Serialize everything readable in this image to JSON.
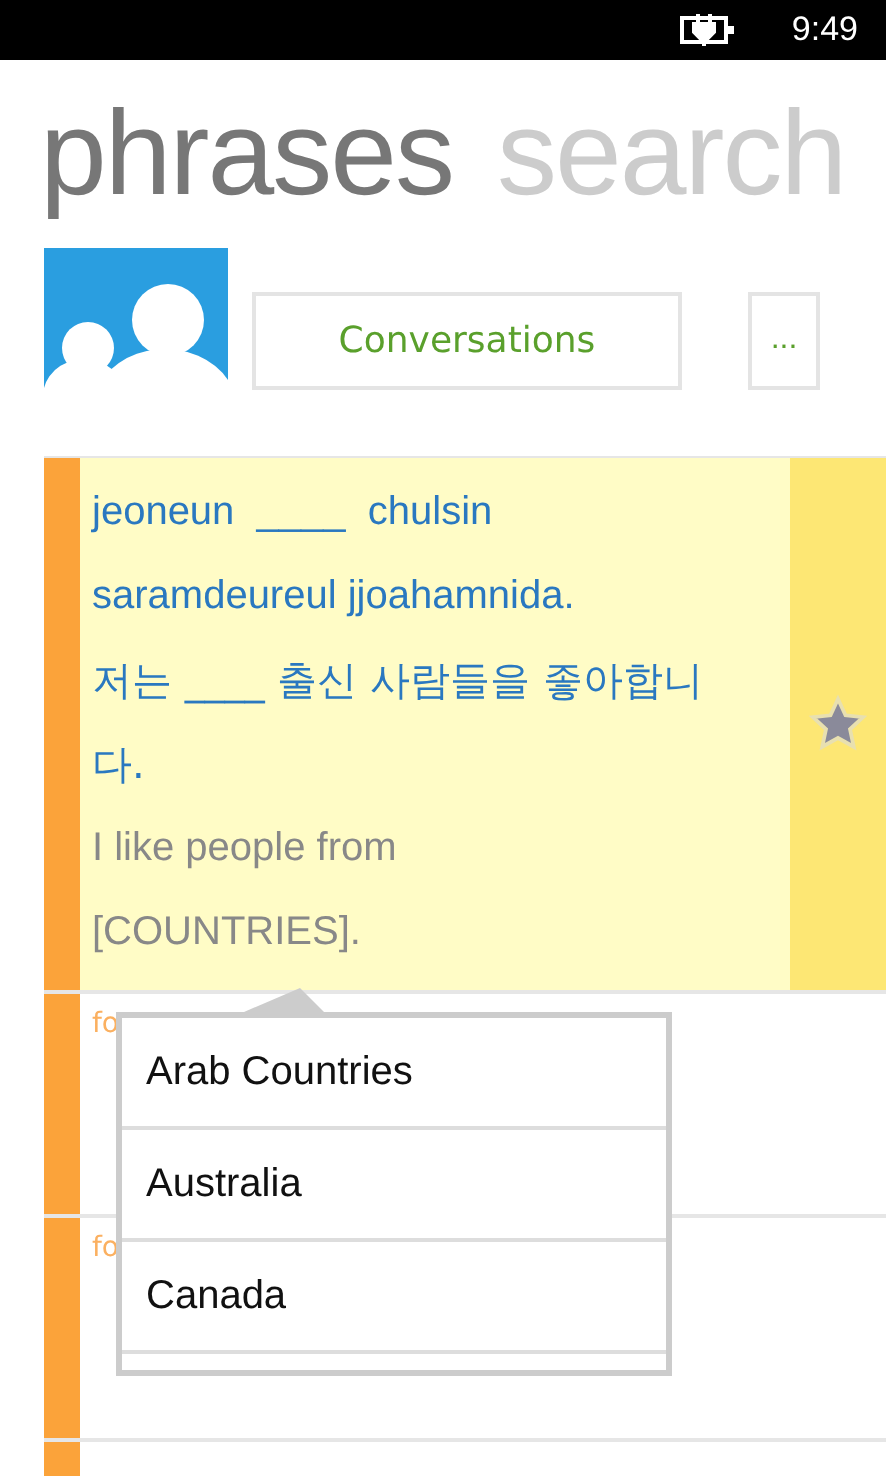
{
  "status_bar": {
    "time": "9:49"
  },
  "pivots": [
    {
      "label": "phrases",
      "selected": true
    },
    {
      "label": "search",
      "selected": false
    }
  ],
  "category": {
    "label": "Conversations",
    "more": "..."
  },
  "phrases": [
    {
      "romanized": "jeoneun  ____  chulsin saramdeureul jjoahamnida.",
      "korean": "저는 ____ 출신 사람들을 좋아합니다.",
      "english": "I like people from [COUNTRIES].",
      "expanded": true,
      "favorite": true
    },
    {
      "tag": "fo",
      "expanded": false
    },
    {
      "tag": "fo",
      "expanded": false
    },
    {
      "expanded": false
    }
  ],
  "popup": {
    "items": [
      {
        "label": "Arab Countries"
      },
      {
        "label": "Australia"
      },
      {
        "label": "Canada"
      }
    ]
  }
}
